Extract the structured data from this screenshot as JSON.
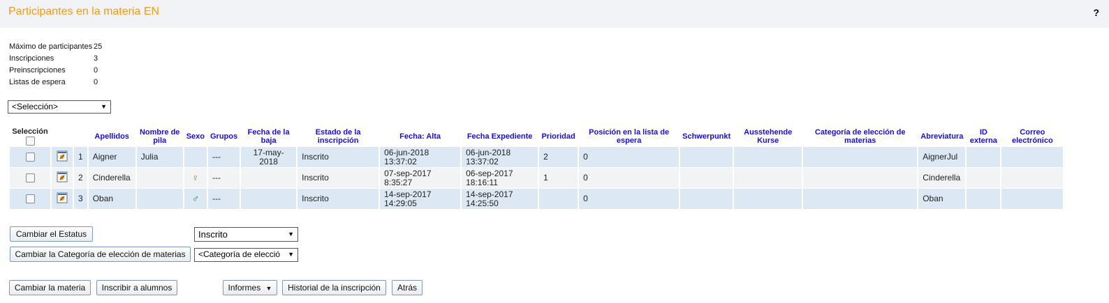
{
  "header": {
    "title": "Participantes en la materia EN",
    "help_label": "?"
  },
  "stats": [
    {
      "label": "Máximo de participantes",
      "value": "25"
    },
    {
      "label": "Inscripciones",
      "value": "3"
    },
    {
      "label": "Preinscripciones",
      "value": "0"
    },
    {
      "label": "Listas de espera",
      "value": "0"
    }
  ],
  "selection_dropdown": {
    "value": "<Selección>"
  },
  "table": {
    "headers": {
      "seleccion": "Selección",
      "apellidos": "Apellidos",
      "nombre": "Nombre de pila",
      "sexo": "Sexo",
      "grupos": "Grupos",
      "fecha_baja": "Fecha de la baja",
      "estado": "Estado de la inscripción",
      "fecha_alta": "Fecha: Alta",
      "fecha_expediente": "Fecha Expediente",
      "prioridad": "Prioridad",
      "posicion": "Posición en la lista de espera",
      "schwerpunkt": "Schwerpunkt",
      "ausstehende": "Ausstehende Kurse",
      "categoria": "Categoría de elección de materias",
      "abreviatura": "Abreviatura",
      "id_externa": "ID externa",
      "correo": "Correo electrónico"
    },
    "rows": [
      {
        "num": "1",
        "apellidos": "Aigner",
        "nombre": "Julia",
        "sexo": "",
        "grupos": "---",
        "fecha_baja": "17-may-2018",
        "estado": "Inscrito",
        "fecha_alta_d": "06-jun-2018",
        "fecha_alta_t": "13:37:02",
        "fecha_exp_d": "06-jun-2018",
        "fecha_exp_t": "13:37:02",
        "prioridad": "2",
        "posicion": "0",
        "schwerpunkt": "",
        "ausstehende": "",
        "categoria": "",
        "abreviatura": "AignerJul",
        "id_externa": "",
        "correo": ""
      },
      {
        "num": "2",
        "apellidos": "Cinderella",
        "nombre": "",
        "sexo": "female-icon",
        "grupos": "---",
        "fecha_baja": "",
        "estado": "Inscrito",
        "fecha_alta_d": "07-sep-2017",
        "fecha_alta_t": "8:35:27",
        "fecha_exp_d": "06-sep-2017",
        "fecha_exp_t": "18:16:11",
        "prioridad": "1",
        "posicion": "0",
        "schwerpunkt": "",
        "ausstehende": "",
        "categoria": "",
        "abreviatura": "Cinderella",
        "id_externa": "",
        "correo": ""
      },
      {
        "num": "3",
        "apellidos": "Oban",
        "nombre": "",
        "sexo": "male-icon",
        "grupos": "---",
        "fecha_baja": "",
        "estado": "Inscrito",
        "fecha_alta_d": "14-sep-2017",
        "fecha_alta_t": "14:29:05",
        "fecha_exp_d": "14-sep-2017",
        "fecha_exp_t": "14:25:50",
        "prioridad": "",
        "posicion": "0",
        "schwerpunkt": "",
        "ausstehende": "",
        "categoria": "",
        "abreviatura": "Oban",
        "id_externa": "",
        "correo": ""
      }
    ]
  },
  "actions": {
    "cambiar_estatus": "Cambiar el Estatus",
    "estatus_value": "Inscrito",
    "cambiar_categoria": "Cambiar la Categoría de elección de materias",
    "categoria_value": "<Categoría de elecció",
    "cambiar_materia": "Cambiar la materia",
    "inscribir": "Inscribir a alumnos",
    "informes": "Informes",
    "historial": "Historial de la inscripción",
    "atras": "Atrás"
  },
  "icons": {
    "female_symbol": "♀",
    "male_symbol": "♂",
    "dropdown_arrow": "▼"
  },
  "colors": {
    "title": "#f39a17",
    "header_link": "#1a0dde",
    "row_blue": "#dce9f4",
    "row_gray": "#f1f3f5"
  }
}
